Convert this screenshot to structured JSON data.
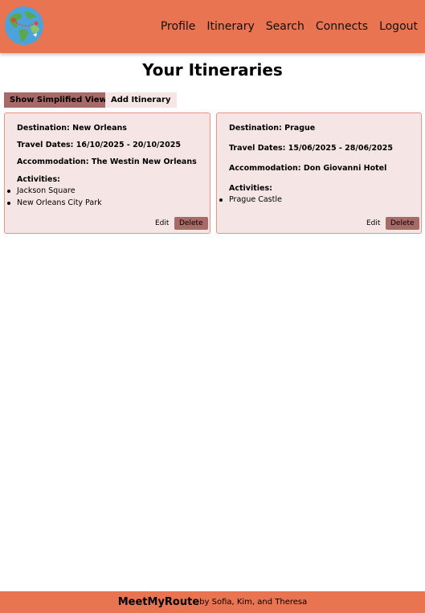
{
  "header": {
    "logo": "globe-logo",
    "nav": [
      "Profile",
      "Itinerary",
      "Search",
      "Connects",
      "Logout"
    ]
  },
  "main": {
    "title": "Your Itineraries",
    "show_simplified_label": "Show Simplified View",
    "add_itinerary_label": "Add Itinerary"
  },
  "itineraries": [
    {
      "destination": "Destination: New Orleans",
      "dates": "Travel Dates: 16/10/2025 - 20/10/2025",
      "accommodation": "Accommodation: The Westin New Orleans",
      "activities_heading": "Activities:",
      "activities": [
        "Jackson Square",
        "New Orleans City Park"
      ],
      "edit_label": "Edit",
      "delete_label": "Delete"
    },
    {
      "destination": "Destination: Prague",
      "dates": "Travel Dates: 15/06/2025 - 28/06/2025",
      "accommodation": "Accommodation: Don Giovanni Hotel",
      "activities_heading": "Activities:",
      "activities": [
        "Prague Castle"
      ],
      "edit_label": "Edit",
      "delete_label": "Delete"
    }
  ],
  "footer": {
    "brand": "MeetMyRoute",
    "credit": "by Sofia, Kim, and Theresa"
  },
  "colors": {
    "header_bg": "#e97451",
    "card_bg": "#f5e6e5",
    "card_border": "#e9938a",
    "accent_button": "#a86a66"
  }
}
